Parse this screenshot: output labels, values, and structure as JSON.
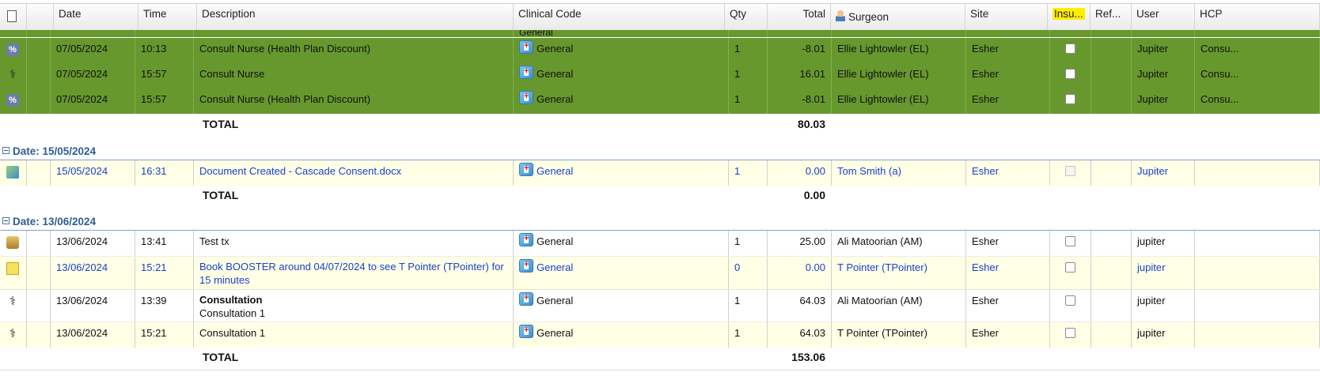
{
  "headers": {
    "date": "Date",
    "time": "Time",
    "description": "Description",
    "clinical_code": "Clinical Code",
    "qty": "Qty",
    "total": "Total",
    "surgeon": "Surgeon",
    "site": "Site",
    "insured": "Insu...",
    "ref": "Ref...",
    "user": "User",
    "hcp": "HCP"
  },
  "top_partial": {
    "clinical_code": "General"
  },
  "rows_a": [
    {
      "icon": "percent-icon",
      "date": "07/05/2024",
      "time": "10:13",
      "description": "Consult Nurse (Health Plan Discount)",
      "code": "General",
      "qty": "1",
      "total": "-8.01",
      "surgeon": "Ellie Lightowler (EL)",
      "site": "Esher",
      "user": "Jupiter",
      "hcp": "Consu..."
    },
    {
      "icon": "stethoscope-icon",
      "date": "07/05/2024",
      "time": "15:57",
      "description": "Consult Nurse",
      "code": "General",
      "qty": "1",
      "total": "16.01",
      "surgeon": "Ellie Lightowler (EL)",
      "site": "Esher",
      "user": "Jupiter",
      "hcp": "Consu..."
    },
    {
      "icon": "percent-icon",
      "date": "07/05/2024",
      "time": "15:57",
      "description": "Consult Nurse (Health Plan Discount)",
      "code": "General",
      "qty": "1",
      "total": "-8.01",
      "surgeon": "Ellie Lightowler (EL)",
      "site": "Esher",
      "user": "Jupiter",
      "hcp": "Consu..."
    }
  ],
  "total_a": {
    "label": "TOTAL",
    "value": "80.03"
  },
  "group_b": {
    "label": "Date: 15/05/2024"
  },
  "row_b": {
    "icon": "document-icon",
    "date": "15/05/2024",
    "time": "16:31",
    "description": "Document Created - Cascade Consent.docx",
    "code": "General",
    "qty": "1",
    "total": "0.00",
    "surgeon": "Tom Smith (a)",
    "site": "Esher",
    "user": "Jupiter"
  },
  "total_b": {
    "label": "TOTAL",
    "value": "0.00"
  },
  "group_c": {
    "label": "Date: 13/06/2024"
  },
  "rows_c": [
    {
      "icon": "database-icon",
      "date": "13/06/2024",
      "time": "13:41",
      "description": "Test tx",
      "code": "General",
      "qty": "1",
      "total": "25.00",
      "surgeon": "Ali Matoorian (AM)",
      "site": "Esher",
      "user": "jupiter"
    },
    {
      "icon": "note-icon",
      "date": "13/06/2024",
      "time": "15:21",
      "description": "Book BOOSTER around 04/07/2024 to see T Pointer (TPointer) for 15 minutes",
      "code": "General",
      "qty": "0",
      "total": "0.00",
      "surgeon": "T Pointer (TPointer)",
      "site": "Esher",
      "user": "jupiter"
    },
    {
      "icon": "stethoscope-icon",
      "date": "13/06/2024",
      "time": "13:39",
      "description": "Consultation",
      "description_sub": "Consultation 1",
      "code": "General",
      "qty": "1",
      "total": "64.03",
      "surgeon": "Ali Matoorian (AM)",
      "site": "Esher",
      "user": "jupiter"
    },
    {
      "icon": "stethoscope-icon",
      "date": "13/06/2024",
      "time": "15:21",
      "description": "Consultation 1",
      "code": "General",
      "qty": "1",
      "total": "64.03",
      "surgeon": "T Pointer (TPointer)",
      "site": "Esher",
      "user": "jupiter"
    }
  ],
  "total_c": {
    "label": "TOTAL",
    "value": "153.06"
  },
  "colors": {
    "green_row": "#67982e",
    "yellow_row": "#ffffe6",
    "link_blue": "#1a3fcf",
    "group_blue": "#2d5d94",
    "highlight": "#ffee00"
  }
}
